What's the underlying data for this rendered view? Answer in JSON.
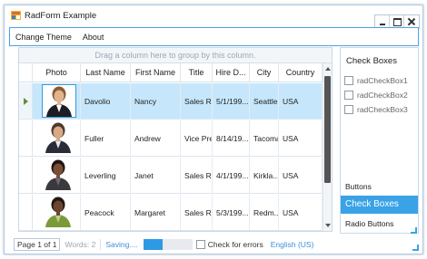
{
  "window": {
    "title": "RadForm Example"
  },
  "menu": {
    "items": [
      "Change Theme",
      "About"
    ]
  },
  "grid": {
    "group_panel_text": "Drag a column here to group by this column.",
    "columns": [
      "Photo",
      "Last Name",
      "First Name",
      "Title",
      "Hire D...",
      "City",
      "Country"
    ],
    "rows": [
      {
        "last": "Davolio",
        "first": "Nancy",
        "title": "Sales  Re...",
        "hire": "5/1/199...",
        "city": "Seattle",
        "country": "USA",
        "selected": true,
        "skin": "#e2b48e",
        "hair": "#8a5a32",
        "suit": "#1e1e22",
        "shirt": "#ffffff"
      },
      {
        "last": "Fuller",
        "first": "Andrew",
        "title": "Vice Pre...",
        "hire": "8/14/19...",
        "city": "Tacoma",
        "country": "USA",
        "selected": false,
        "skin": "#d9a983",
        "hair": "#4a3a30",
        "suit": "#2a2c38",
        "shirt": "#e8e8ee"
      },
      {
        "last": "Leverling",
        "first": "Janet",
        "title": "Sales  Re...",
        "hire": "4/1/199...",
        "city": "Kirkla...",
        "country": "USA",
        "selected": false,
        "skin": "#7a4f36",
        "hair": "#1e1410",
        "suit": "#3a3a3e",
        "shirt": "#6a6a70"
      },
      {
        "last": "Peacock",
        "first": "Margaret",
        "title": "Sales  Re...",
        "hire": "5/3/199...",
        "city": "Redm...",
        "country": "USA",
        "selected": false,
        "skin": "#6c4530",
        "hair": "#201612",
        "suit": "#7a9a3a",
        "shirt": "#bfcf8a"
      }
    ]
  },
  "panel": {
    "title": "Check Boxes",
    "checkboxes": [
      "radCheckBox1",
      "radCheckBox2",
      "radCheckBox3"
    ],
    "nav": [
      "Buttons",
      "Check Boxes",
      "Radio Buttons"
    ],
    "active_nav": "Check Boxes"
  },
  "status": {
    "page": "Page 1 of 1",
    "words": "Words: 2",
    "saving": "Saving....",
    "progress": 0.4,
    "check_label": "Check for errors",
    "language": "English (US)"
  },
  "colors": {
    "accent": "#3aa2e6",
    "selected_row": "#c6e7fb"
  }
}
